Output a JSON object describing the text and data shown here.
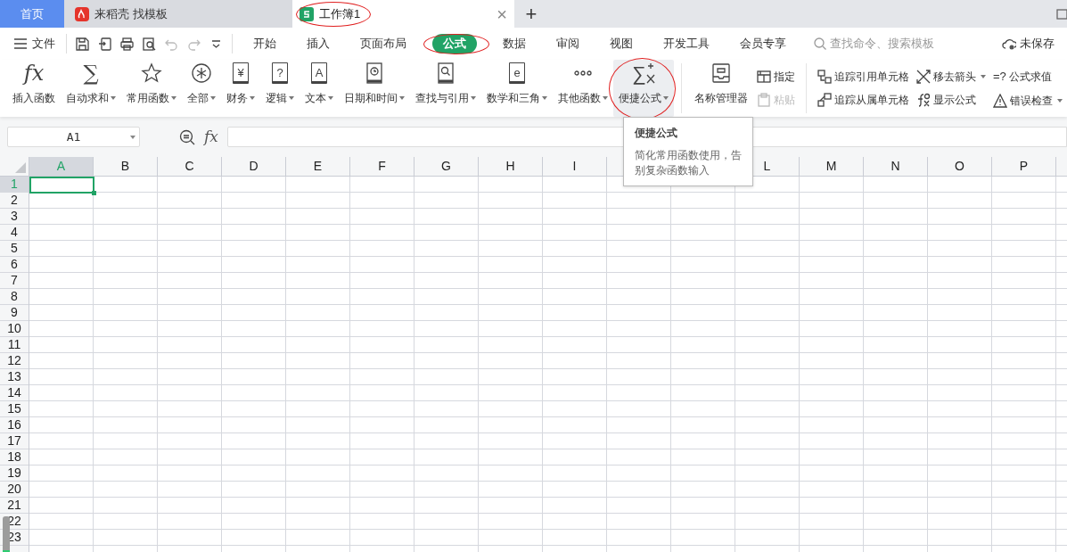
{
  "tabs": [
    {
      "kind": "home",
      "label": "首页",
      "selected": false,
      "circled": false
    },
    {
      "kind": "docer",
      "label": "来稻壳 找模板",
      "selected": false,
      "circled": false
    },
    {
      "kind": "sheet",
      "label": "工作簿1",
      "selected": true,
      "circled": true,
      "close": "×"
    }
  ],
  "new_tab": "+",
  "menu": {
    "file": "文件",
    "tabs": [
      {
        "label": "开始",
        "selected": false,
        "circled": false
      },
      {
        "label": "插入",
        "selected": false,
        "circled": false
      },
      {
        "label": "页面布局",
        "selected": false,
        "circled": false
      },
      {
        "label": "公式",
        "selected": true,
        "circled": true
      },
      {
        "label": "数据",
        "selected": false,
        "circled": false
      },
      {
        "label": "审阅",
        "selected": false,
        "circled": false
      },
      {
        "label": "视图",
        "selected": false,
        "circled": false
      },
      {
        "label": "开发工具",
        "selected": false,
        "circled": false
      },
      {
        "label": "会员专享",
        "selected": false,
        "circled": false
      }
    ],
    "search": {
      "placeholder": "查找命令、搜索模板"
    },
    "save_status": "未保存"
  },
  "ribbon": [
    {
      "kind": "big",
      "label": "插入函数",
      "glyph": "fx",
      "dropdown": false,
      "hovered": false,
      "circled": false
    },
    {
      "kind": "big",
      "label": "自动求和",
      "glyph": "∑",
      "dropdown": true,
      "hovered": false,
      "circled": false
    },
    {
      "kind": "big",
      "label": "常用函数",
      "dropdown": true,
      "hovered": false,
      "circled": false
    },
    {
      "kind": "big",
      "label": "全部",
      "dropdown": true,
      "hovered": false,
      "circled": false
    },
    {
      "kind": "big",
      "label": "财务",
      "glyph": "¥",
      "dropdown": true,
      "hovered": false,
      "circled": false
    },
    {
      "kind": "big",
      "label": "逻辑",
      "glyph": "?",
      "dropdown": true,
      "hovered": false,
      "circled": false
    },
    {
      "kind": "big",
      "label": "文本",
      "glyph": "A",
      "dropdown": true,
      "hovered": false,
      "circled": false
    },
    {
      "kind": "big",
      "label": "日期和时间",
      "dropdown": true,
      "hovered": false,
      "circled": false
    },
    {
      "kind": "big",
      "label": "查找与引用",
      "dropdown": true,
      "hovered": false,
      "circled": false
    },
    {
      "kind": "big",
      "label": "数学和三角",
      "glyph": "e",
      "dropdown": true,
      "hovered": false,
      "circled": false
    },
    {
      "kind": "big",
      "label": "其他函数",
      "dropdown": true,
      "hovered": false,
      "circled": false
    },
    {
      "kind": "big",
      "label": "便捷公式",
      "glyph": "∑",
      "dropdown": true,
      "hovered": true,
      "circled": true
    },
    {
      "kind": "separator"
    },
    {
      "kind": "big",
      "label": "名称管理器",
      "dropdown": false,
      "hovered": false,
      "circled": false
    },
    {
      "kind": "pair",
      "items": [
        {
          "label": "指定",
          "disabled": false,
          "dropdown": false
        },
        {
          "label": "粘贴",
          "disabled": true,
          "dropdown": false
        }
      ]
    },
    {
      "kind": "separator"
    },
    {
      "kind": "pair",
      "items": [
        {
          "label": "追踪引用单元格",
          "disabled": false,
          "dropdown": false
        },
        {
          "label": "追踪从属单元格",
          "disabled": false,
          "dropdown": false
        }
      ]
    },
    {
      "kind": "pair",
      "items": [
        {
          "label": "移去箭头",
          "disabled": false,
          "dropdown": true
        },
        {
          "label": "显示公式",
          "disabled": false,
          "dropdown": false
        }
      ]
    },
    {
      "kind": "pair",
      "items": [
        {
          "label": "公式求值",
          "glyph": "=?",
          "disabled": false,
          "dropdown": false
        },
        {
          "label": "错误检查",
          "disabled": false,
          "dropdown": true
        }
      ]
    }
  ],
  "formula_bar": {
    "name_box": "A1",
    "fx": "fx"
  },
  "tooltip": {
    "title": "便捷公式",
    "text": "简化常用函数使用，告别复杂函数输入"
  },
  "sheet": {
    "columns_left": [
      {
        "label": "A",
        "selected": true
      },
      {
        "label": "B",
        "selected": false
      },
      {
        "label": "C",
        "selected": false
      },
      {
        "label": "D",
        "selected": false
      },
      {
        "label": "E",
        "selected": false
      },
      {
        "label": "F",
        "selected": false
      },
      {
        "label": "G",
        "selected": false
      },
      {
        "label": "H",
        "selected": false
      },
      {
        "label": "I",
        "selected": false
      }
    ],
    "columns_right": [
      {
        "label": "L",
        "selected": false
      },
      {
        "label": "M",
        "selected": false
      },
      {
        "label": "N",
        "selected": false
      },
      {
        "label": "O",
        "selected": false
      },
      {
        "label": "P",
        "selected": false
      }
    ],
    "rows": [
      {
        "label": "1",
        "selected": true
      },
      {
        "label": "2",
        "selected": false
      },
      {
        "label": "3",
        "selected": false
      },
      {
        "label": "4",
        "selected": false
      },
      {
        "label": "5",
        "selected": false
      },
      {
        "label": "6",
        "selected": false
      },
      {
        "label": "7",
        "selected": false
      },
      {
        "label": "8",
        "selected": false
      },
      {
        "label": "9",
        "selected": false
      },
      {
        "label": "10",
        "selected": false
      },
      {
        "label": "11",
        "selected": false
      },
      {
        "label": "12",
        "selected": false
      },
      {
        "label": "13",
        "selected": false
      },
      {
        "label": "14",
        "selected": false
      },
      {
        "label": "15",
        "selected": false
      },
      {
        "label": "16",
        "selected": false
      },
      {
        "label": "17",
        "selected": false
      },
      {
        "label": "18",
        "selected": false
      },
      {
        "label": "19",
        "selected": false
      },
      {
        "label": "20",
        "selected": false
      },
      {
        "label": "21",
        "selected": false
      },
      {
        "label": "22",
        "selected": false
      },
      {
        "label": "23",
        "selected": false
      }
    ]
  }
}
